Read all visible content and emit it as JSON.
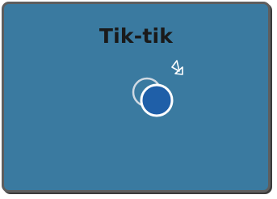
{
  "dialog": {
    "title": "Tik-tik"
  },
  "icons": {
    "illustration": "tap-icon"
  },
  "colors": {
    "background": "#3a7aa0",
    "border": "#5e5e5e",
    "circle_fill": "#1f5fa8",
    "stroke": "#ffffff",
    "title_text": "#1a1a1a"
  }
}
